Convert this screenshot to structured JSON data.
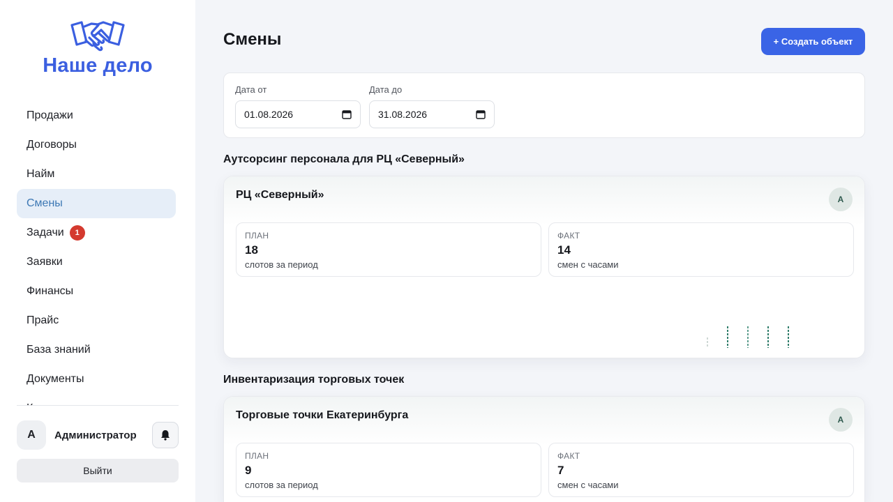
{
  "brand": {
    "name": "Наше дело",
    "icon": "handshake-icon",
    "color": "#3b5fe0"
  },
  "sidebar": {
    "items": [
      {
        "label": "Продажи",
        "active": false
      },
      {
        "label": "Договоры",
        "active": false
      },
      {
        "label": "Найм",
        "active": false
      },
      {
        "label": "Смены",
        "active": true
      },
      {
        "label": "Задачи",
        "active": false,
        "badge": "1"
      },
      {
        "label": "Заявки",
        "active": false
      },
      {
        "label": "Финансы",
        "active": false
      },
      {
        "label": "Прайс",
        "active": false
      },
      {
        "label": "База знаний",
        "active": false
      },
      {
        "label": "Документы",
        "active": false
      },
      {
        "label": "К",
        "active": false
      }
    ],
    "user": {
      "initial": "A",
      "name": "Администратор",
      "notification_icon": "bell-icon"
    },
    "logout_label": "Выйти"
  },
  "page": {
    "title": "Смены",
    "create_button": "+ Создать объект",
    "accent_color": "#3a64e6"
  },
  "filters": {
    "date_from": {
      "label": "Дата от",
      "value": "01.08.2026",
      "icon": "calendar-icon"
    },
    "date_to": {
      "label": "Дата до",
      "value": "31.08.2026",
      "icon": "calendar-icon"
    }
  },
  "sections": [
    {
      "title": "Аутсорсинг персонала для РЦ «Северный»",
      "card": {
        "title": "РЦ «Северный»",
        "avatar": "A",
        "plan": {
          "label": "ПЛАН",
          "value": "18",
          "sub": "слотов за период"
        },
        "fact": {
          "label": "ФАКТ",
          "value": "14",
          "sub": "смен с часами"
        }
      }
    },
    {
      "title": "Инвентаризация торговых точек",
      "card": {
        "title": "Торговые точки Екатеринбурга",
        "avatar": "A",
        "plan": {
          "label": "ПЛАН",
          "value": "9",
          "sub": "слотов за период"
        },
        "fact": {
          "label": "ФАКТ",
          "value": "7",
          "sub": "смен с часами"
        }
      }
    }
  ],
  "colors": {
    "active_nav_bg": "#e6eef8",
    "active_nav_text": "#3d78b4",
    "badge": "#d43a2f",
    "bar_color": "#2f7d6a"
  }
}
